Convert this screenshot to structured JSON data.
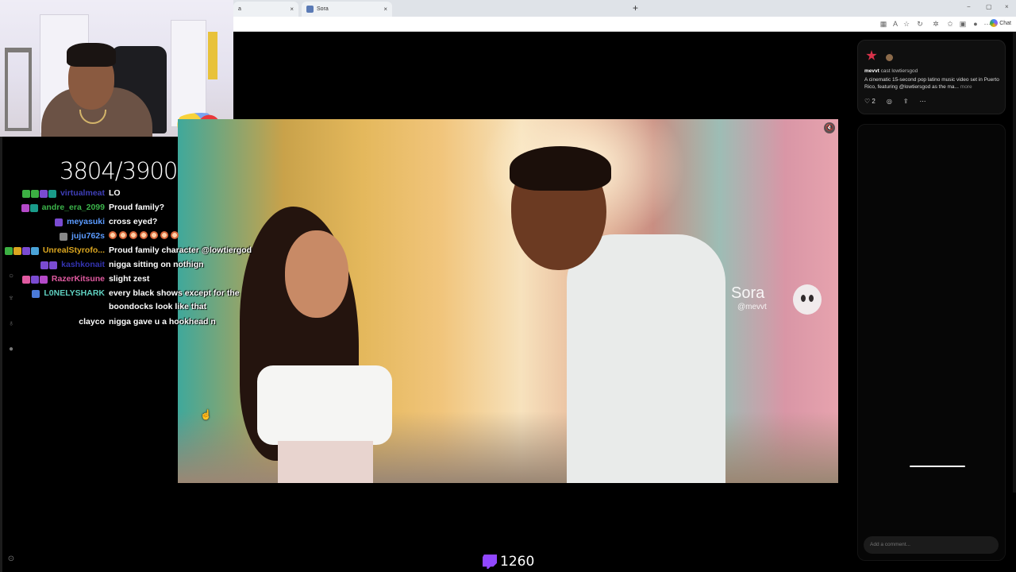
{
  "browser": {
    "tabs": [
      {
        "label": "a",
        "close": "×"
      },
      {
        "label": "Sora",
        "close": "×"
      }
    ],
    "new_tab": "+",
    "chat_label": "Chat",
    "window_controls": [
      "−",
      "▢",
      "×"
    ]
  },
  "stream": {
    "counter": "3804/3900",
    "viewer_count": "1260"
  },
  "chat": [
    {
      "user": "virtualmeat",
      "user_color": "#3f3fb8",
      "msg": "LO",
      "badges": [
        "#3cb043",
        "#3cb043",
        "#7a4bd1",
        "#1a9b8a"
      ]
    },
    {
      "user": "andre_era_2099",
      "user_color": "#3bb34a",
      "msg": "Proud family?",
      "badges": [
        "#b449c8",
        "#1a9b8a"
      ]
    },
    {
      "user": "meyasuki",
      "user_color": "#5b9bff",
      "msg": "cross eyed?",
      "badges": [
        "#7a4bd1"
      ]
    },
    {
      "user": "juju762s",
      "user_color": "#5b9bff",
      "msg": "",
      "emotes": 7,
      "badges": [
        "#888"
      ]
    },
    {
      "user": "UnrealStyrofo...",
      "user_color": "#daa520",
      "msg": "Proud family character @lowtiergod",
      "badges": [
        "#3cb043",
        "#daa520",
        "#7a4bd1",
        "#4aa3d8"
      ]
    },
    {
      "user": "kashkonait",
      "user_color": "#3333b0",
      "msg": "nigga sitting on nothign",
      "badges": [
        "#7a4bd1",
        "#7a4bd1"
      ]
    },
    {
      "user": "RazerKitsune",
      "user_color": "#e05aa0",
      "msg": "slight zest",
      "badges": [
        "#e05aa0",
        "#7a4bd1",
        "#b449c8"
      ]
    },
    {
      "user": "L0NELYSHARK",
      "user_color": "#5fd0c0",
      "msg": "every black shows except for the",
      "msg2": "boondocks look like that",
      "badges": [
        "#4a7ad8"
      ]
    },
    {
      "user": "clayco",
      "user_color": "#ffffff",
      "msg": "nigga gave u a hookhead n",
      "badges": []
    }
  ],
  "video": {
    "watermark_title": "Sora",
    "watermark_handle": "@mevvt",
    "mute_icon": "speaker-muted-icon"
  },
  "sora_panel": {
    "author": "mevvt",
    "cast_label": "cast",
    "cast_user": "lowtiersgod",
    "description": "A cinematic 15-second pop latino music video set in Puerto Rico, featuring @lowtiersgod as the ma...",
    "more": "more",
    "like_count": "2",
    "comment_placeholder": "Add a comment..."
  },
  "colors": {
    "twitch": "#9147ff",
    "background": "#000000"
  }
}
